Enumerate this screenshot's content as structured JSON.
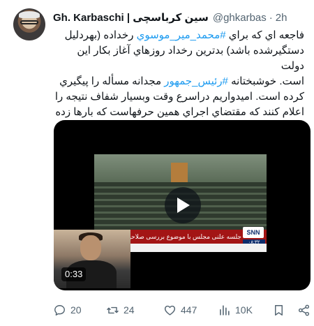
{
  "author": {
    "display_name": "Gh. Karbaschi | سین کرباسچی",
    "handle": "@ghkarbas",
    "separator": "·",
    "time": "2h"
  },
  "tweet": {
    "line1_a": "فاجعه اي كه براي ",
    "hashtag1": "#محمد_مير_موسوي",
    "line1_b": " رخداده (بهردليل",
    "line2": "دستگيرشده باشد) بدترين رخداد روزهاي آغاز بكار اين دولت",
    "line3_a": "است. خوشبختانه ",
    "hashtag2": "#رئيس_جمهور",
    "line3_b": " مجدانه مسأله را پيگيري",
    "line4": "كرده است. اميدواريم دراسرع وقت وبسيار شفاف نتيجه را",
    "line5": "اعلام كنند كه مقتضاي اجراي همين حرفهاست كه بارها زده اند:"
  },
  "video": {
    "duration": "0:33",
    "lower_third": "جلسه علنی مجلس با موضوع بررسی صلاحیت وزرای کابینه",
    "ticker": "www.snn.ir",
    "channel_logo": "SNN",
    "clock": "۰۸:۳۲"
  },
  "actions": {
    "reply_count": "20",
    "retweet_count": "24",
    "like_count": "447",
    "views_count": "10K",
    "icons": [
      "reply-icon",
      "retweet-icon",
      "like-icon",
      "views-icon",
      "bookmark-icon",
      "share-icon"
    ]
  },
  "colors": {
    "link": "#1d9bf0",
    "secondary_text": "#536471",
    "primary_text": "#0f1419"
  }
}
